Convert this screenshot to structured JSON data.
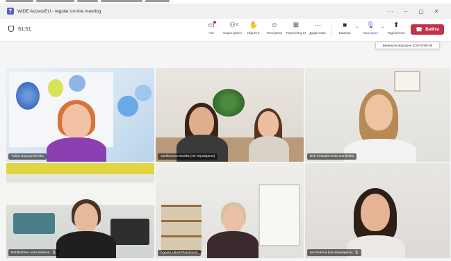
{
  "window": {
    "icon": "teams-icon",
    "title": "WiDE AccessEU - regular on-line meeting",
    "controls": [
      "···",
      "–",
      "▢",
      "✕"
    ]
  },
  "toolbar": {
    "timer": "51:51",
    "tools": [
      {
        "name": "chat",
        "icon": "chat-icon",
        "label": "Чат"
      },
      {
        "name": "people",
        "icon": "people-icon",
        "label": "Користувачі",
        "badge": "6"
      },
      {
        "name": "raise-hand",
        "icon": "hand-icon",
        "label": "Підняти"
      },
      {
        "name": "react",
        "icon": "smile-icon",
        "label": "Реагувати"
      },
      {
        "name": "view",
        "icon": "grid-icon",
        "label": "Переглянути"
      },
      {
        "name": "more",
        "icon": "more-icon",
        "label": "Додатково"
      },
      {
        "name": "camera",
        "icon": "camera-icon",
        "label": "Камера"
      },
      {
        "name": "mic",
        "icon": "mic-icon",
        "label": "Мікрофон"
      },
      {
        "name": "share",
        "icon": "share-icon",
        "label": "Поділитися"
      }
    ],
    "leave_label": "Вийти"
  },
  "tooltip": "Вимкнути мікрофон (Ctrl+Shift+M)",
  "participants": [
    {
      "name": "Yuliya Bogoyavlenska",
      "muted": false
    },
    {
      "name": "Vaclbodova Monika (Не перевірено)",
      "muted": false
    },
    {
      "name": "Beti Kostadinovska Daniloska",
      "muted": false
    },
    {
      "name": "Rohlfechner Auto Marlene",
      "muted": true
    },
    {
      "name": "Agneta Hibell Plamboeck",
      "muted": false
    },
    {
      "name": "Iva Petrova (Не перевірено)",
      "muted": true
    }
  ],
  "colors": {
    "accent": "#5b5fc7",
    "leave": "#c4314b"
  }
}
